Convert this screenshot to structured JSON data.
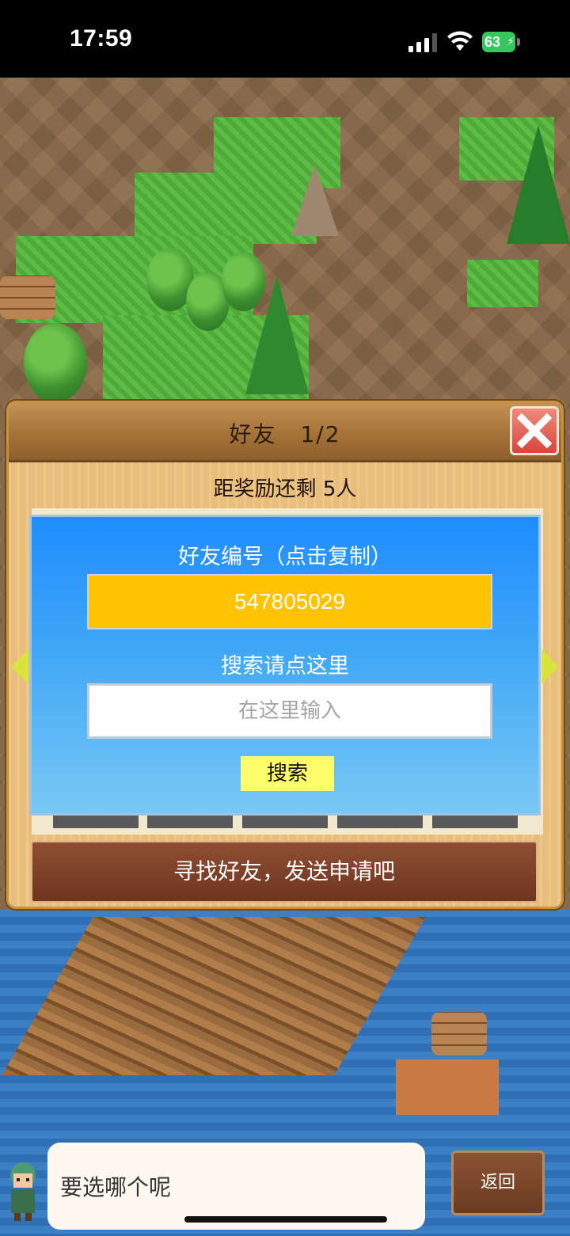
{
  "status_bar": {
    "time": "17:59",
    "battery_level": "63",
    "battery_color": "#34c759",
    "icons": [
      "cellular-signal-icon",
      "wifi-icon",
      "battery-charging-icon"
    ]
  },
  "dialog": {
    "title": "好友",
    "page": "1/2",
    "reward_text": "距奖励还剩 5人",
    "close_icon": "close-x-icon"
  },
  "popup": {
    "code_label": "好友编号（点击复制）",
    "friend_code": "547805029",
    "search_label": "搜索请点这里",
    "search_placeholder": "在这里输入",
    "search_button": "搜索",
    "accent_color": "#fec302"
  },
  "action_button": "寻找好友，发送申请吧",
  "bottom": {
    "speech_text": "要选哪个呢",
    "back_button": "返回"
  }
}
